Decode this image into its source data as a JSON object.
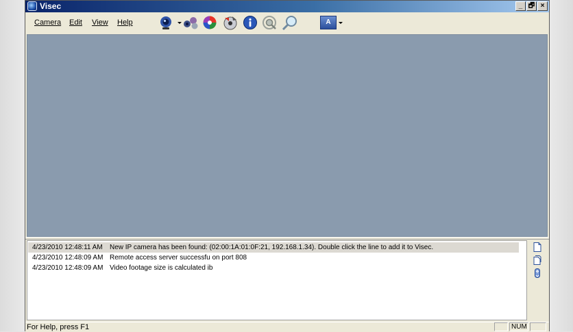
{
  "window": {
    "title": "Visec",
    "minimize": "_",
    "restore": "🗗",
    "close": "×"
  },
  "menu": [
    {
      "label": "Camera"
    },
    {
      "label": "Edit"
    },
    {
      "label": "View"
    },
    {
      "label": "Help"
    }
  ],
  "toolbar": {
    "buttons": [
      {
        "icon": "webcam-icon"
      },
      {
        "icon": "camera-group-icon"
      },
      {
        "icon": "color-wheel-icon"
      },
      {
        "icon": "burn-disc-icon"
      },
      {
        "icon": "info-icon"
      },
      {
        "icon": "remote-access-icon"
      },
      {
        "icon": "search-icon"
      }
    ],
    "font_button": "A"
  },
  "log": {
    "rows": [
      {
        "time": "4/23/2010 12:48:11 AM",
        "message": "New IP camera has been found: (02:00:1A:01:0F:21, 192.168.1.34). Double click the line to add it to Visec."
      },
      {
        "time": "4/23/2010 12:48:09 AM",
        "message": "Remote access server successfu on port 808"
      },
      {
        "time": "4/23/2010 12:48:09 AM",
        "message": "Video footage size is calculated ib"
      }
    ]
  },
  "side_buttons": [
    {
      "icon": "new-document-icon"
    },
    {
      "icon": "copy-document-icon"
    },
    {
      "icon": "scroll-lock-icon"
    }
  ],
  "status": {
    "help": "For Help, press F1",
    "num": "NUM"
  }
}
